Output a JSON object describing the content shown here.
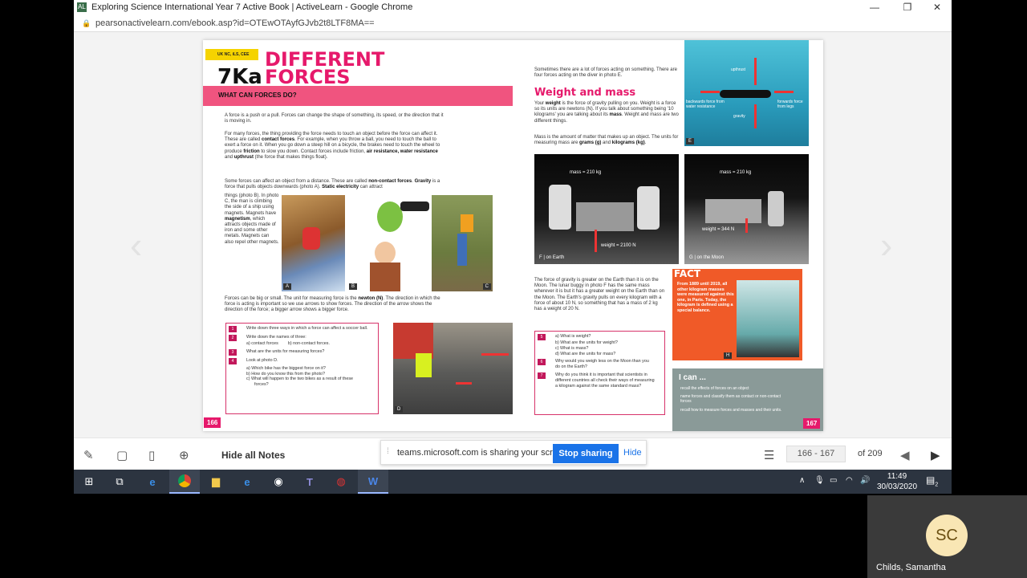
{
  "window": {
    "title": "Exploring Science International Year 7 Active Book | ActiveLearn - Google Chrome",
    "app_icon": "AL",
    "url": "pearsonactivelearn.com/ebook.asp?id=OTEwOTAyfGJvb2t8LTF8MA=="
  },
  "left_page": {
    "badge": "UK NC, iLS, CEE",
    "code": "7Ka",
    "title_line1": "DIFFERENT",
    "title_line2": "FORCES",
    "section": "WHAT CAN FORCES DO?",
    "p1": "A force is a push or a pull. Forces can change the shape of something, its speed, or the direction that it is moving in.",
    "p2a": "For many forces, the thing providing the force needs to touch an object before the force can affect it. These are called ",
    "p2b": "contact forces",
    "p2c": ". For example, when you throw a ball, you need to touch the ball to exert a force on it. When you go down a steep hill on a bicycle, the brakes need to touch the wheel to produce ",
    "p2d": "friction",
    "p2e": " to slow you down. Contact forces include friction, ",
    "p2f": "air resistance, water resistance",
    "p2g": " and ",
    "p2h": "upthrust",
    "p2i": " (the force that makes things float).",
    "p3a": "Some forces can affect an object from a distance. These are called ",
    "p3b": "non-contact forces",
    "p3c": ". ",
    "p3d": "Gravity",
    "p3e": " is a force that pulls objects downwards (photo A). ",
    "p3f": "Static electricity",
    "p3g": " can attract",
    "p3h": "things (photo B). In photo C, the man is climbing the side of a ship using magnets. Magnets have ",
    "p3i": "magnetism",
    "p3j": ", which attracts objects made of iron and some other metals. Magnets can also repel other magnets.",
    "p4a": "Forces can be big or small. The unit for measuring force is the ",
    "p4b": "newton (N)",
    "p4c": ". The direction in which the force is acting is important so we use arrows to show forces. The direction of the arrow shows the direction of the force; a bigger arrow shows a bigger force.",
    "photo_a": "A",
    "photo_b": "B",
    "photo_c": "C",
    "photo_d": "D",
    "q1": "Write down three ways in which a force can affect a soccer ball.",
    "q2": "Write down the names of three:",
    "q2a": "a)  contact forces",
    "q2b": "b)  non-contact forces.",
    "q3": "What are the units for measuring forces?",
    "q4": "Look at photo D.",
    "q4a": "a)  Which bike has the biggest force on it?",
    "q4b": "b)  How do you know this from the photo?",
    "q4c1": "c)  What will happen to the two bikes as a result of these",
    "q4c2": "forces?",
    "n1": "1",
    "n2": "2",
    "n3": "3",
    "n4": "4",
    "page_num": "166"
  },
  "right_page": {
    "intro": "Sometimes there are a lot of forces acting on something. There are four forces acting on the diver in photo E.",
    "heading": "Weight and mass",
    "p1a": "Your ",
    "p1b": "weight",
    "p1c": " is the force of gravity pulling on you. Weight is a force so its units are newtons (N). If you talk about something being '10 kilograms' you are talking about its ",
    "p1d": "mass",
    "p1e": ". Weight and mass are two different things.",
    "p2a": "Mass is the amount of matter that makes up an object. The units for measuring mass are ",
    "p2b": "grams (g)",
    "p2c": " and ",
    "p2d": "kilograms (kg)",
    "p2e": ".",
    "diver_upthrust": "upthrust",
    "diver_backwards": "backwards force from water resistance",
    "diver_forwards": "forwards force from legs",
    "diver_gravity": "gravity",
    "photo_e": "E",
    "mass_f": "mass = 210 kg",
    "weight_f": "weight = 2100 N",
    "caption_f": "F | on Earth",
    "mass_g": "mass = 210 kg",
    "weight_g": "weight = 344 N",
    "caption_g": "G | on the Moon",
    "p3": "The force of gravity is greater on the Earth than it is on the Moon. The lunar buggy in photo F has the same mass wherever it is but it has a greater weight on the Earth than on the Moon. The Earth's gravity pulls on every kilogram with a force of about 10 N, so something that has a mass of 2 kg has a weight of 20 N.",
    "fact_title": "FACT",
    "fact_text": "From 1889 until 2019, all other kilogram masses were measured against this one, in Paris. Today, the kilogram is defined using a special balance.",
    "photo_h": "H",
    "q5": "5",
    "q5a": "a)  What is weight?",
    "q5b": "b)  What are the units for weight?",
    "q5c": "c)  What is mass?",
    "q5d": "d)  What are the units for mass?",
    "q6": "6",
    "q6t": "Why would you weigh less on the Moon than you do on the Earth?",
    "q7": "7",
    "q7t": "Why do you think it is important that scientists in different countries all check their ways of measuring a kilogram against the same standard mass?",
    "ican_title": "I can ...",
    "ican1": "recall the effects of forces on an object",
    "ican2": "name forces and classify them as contact or non-contact forces",
    "ican3": "recall how to measure forces and masses and their units.",
    "page_num": "167"
  },
  "toolbar": {
    "hide_notes": "Hide all Notes",
    "page_range": "166 - 167",
    "page_of": "of 209"
  },
  "share_bar": {
    "message": "teams.microsoft.com is sharing your screen.",
    "stop_label": "Stop sharing",
    "hide_label": "Hide"
  },
  "taskbar": {
    "time": "11:49",
    "date": "30/03/2020",
    "notif_count": "2"
  },
  "video_tile": {
    "initials": "SC",
    "name": "Childs, Samantha"
  }
}
